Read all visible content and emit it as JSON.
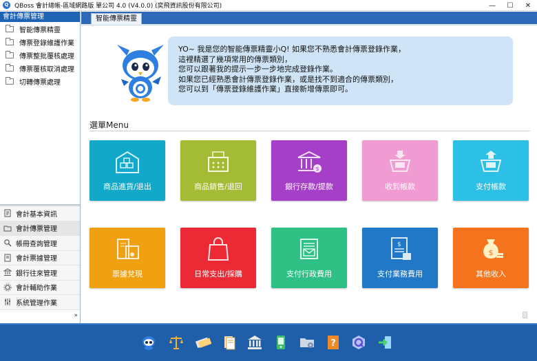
{
  "window": {
    "title": "QBoss 會計總帳-區域網路版 單公司 4.0 (V4.0.0) (奕飛資訊股份有限公司)",
    "controls": {
      "minimize": "—",
      "maximize": "☐",
      "close": "✕"
    }
  },
  "sidebar": {
    "header": "會計傳票管理",
    "tree": [
      {
        "label": "智能傳票精靈"
      },
      {
        "label": "傳票登錄維護作業"
      },
      {
        "label": "傳票整批覆核處理"
      },
      {
        "label": "傳票覆核取消處理"
      },
      {
        "label": "切轉傳票處理"
      }
    ],
    "nav": [
      {
        "label": "會計基本資訊",
        "icon": "document-icon"
      },
      {
        "label": "會計傳票管理",
        "icon": "folder-icon"
      },
      {
        "label": "帳冊查詢管理",
        "icon": "search-icon"
      },
      {
        "label": "會計票據管理",
        "icon": "document-icon"
      },
      {
        "label": "銀行往來管理",
        "icon": "bank-icon"
      },
      {
        "label": "會計輔助作業",
        "icon": "gear-icon"
      },
      {
        "label": "系統管理作業",
        "icon": "sliders-icon"
      }
    ]
  },
  "tabs": [
    {
      "label": "智能傳票精靈"
    }
  ],
  "assistant": {
    "lines": [
      "YO~ 我是您的智能傳票精靈小Q! 如果您不熟悉會計傳票登錄作業，",
      "這裡精選了幾項常用的傳票類別，",
      "您可以跟著我的提示一步一步地完成登錄作業。",
      "如果您已經熟悉會計傳票登錄作業，或是找不到適合的傳票類別，",
      "您可以到「傳票登錄維護作業」直接新增傳票即可。"
    ]
  },
  "menu": {
    "title": "選單Menu",
    "tiles": [
      {
        "label": "商品進貨/退出",
        "color": "#12a8c9",
        "icon": "warehouse-icon"
      },
      {
        "label": "商品銷售/退回",
        "color": "#a3bb35",
        "icon": "cash-register-icon"
      },
      {
        "label": "銀行存款/提款",
        "color": "#a53fc8",
        "icon": "bank-icon"
      },
      {
        "label": "收到帳款",
        "color": "#f09bd2",
        "icon": "receive-money-icon"
      },
      {
        "label": "支付帳款",
        "color": "#2cc0e6",
        "icon": "pay-money-icon"
      },
      {
        "label": "票據兌現",
        "color": "#efa112",
        "icon": "cheque-icon"
      },
      {
        "label": "日常支出/採購",
        "color": "#ec2a35",
        "icon": "shopping-bag-icon"
      },
      {
        "label": "支付行政費用",
        "color": "#2fc085",
        "icon": "newspaper-icon"
      },
      {
        "label": "支付業務費用",
        "color": "#2178c6",
        "icon": "invoice-icon"
      },
      {
        "label": "其他收入",
        "color": "#f5731c",
        "icon": "money-bag-icon"
      }
    ]
  },
  "taskbar": {
    "icons": [
      "mascot-icon",
      "scales-icon",
      "cheque-icon",
      "documents-icon",
      "bank-icon",
      "phone-icon",
      "folder-settings-icon",
      "help-icon",
      "qboss-logo-icon",
      "exit-icon"
    ]
  }
}
